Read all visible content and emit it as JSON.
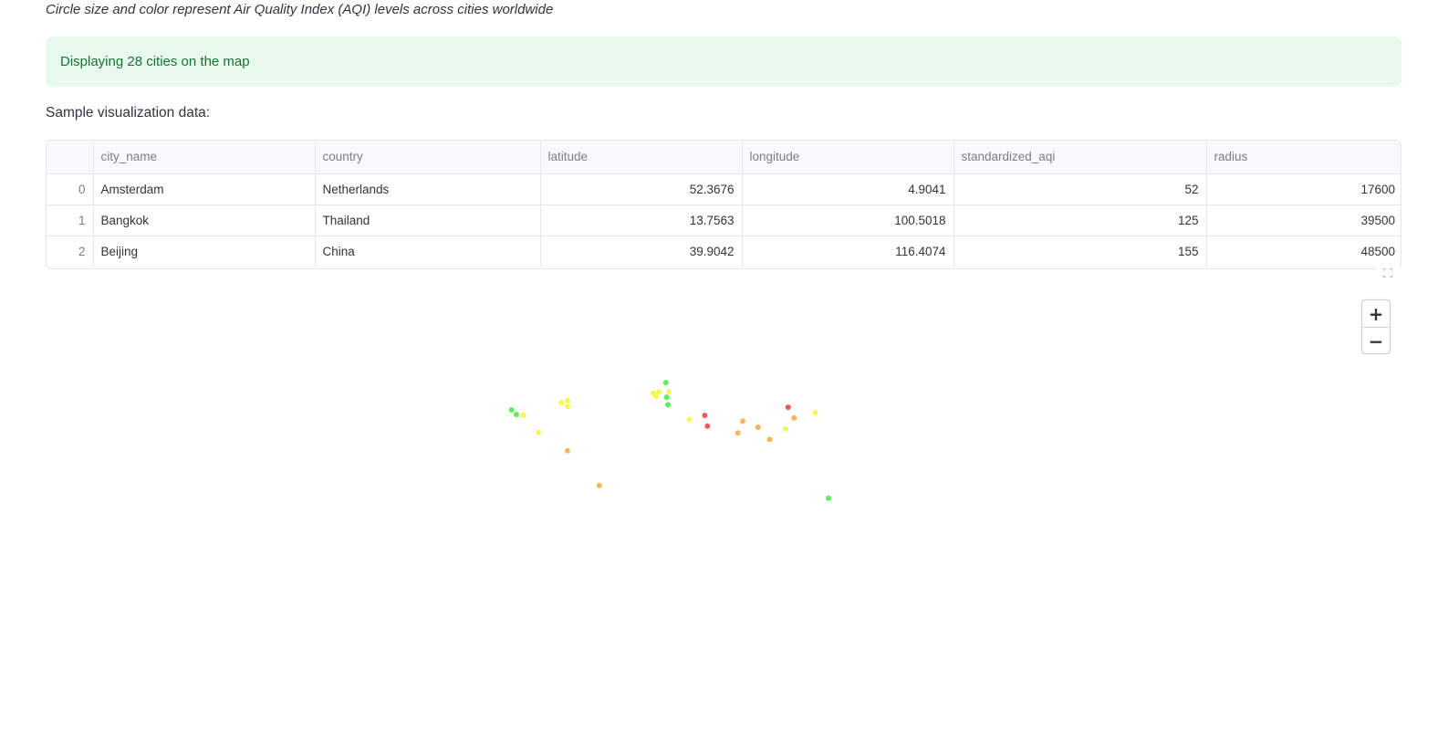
{
  "caption": "Circle size and color represent Air Quality Index (AQI) levels across cities worldwide",
  "success_message": "Displaying 28 cities on the map",
  "table_heading": "Sample visualization data:",
  "table": {
    "columns": [
      "",
      "city_name",
      "country",
      "latitude",
      "longitude",
      "standardized_aqi",
      "radius"
    ],
    "rows": [
      [
        "0",
        "Amsterdam",
        "Netherlands",
        "52.3676",
        "4.9041",
        "52",
        "17600"
      ],
      [
        "1",
        "Bangkok",
        "Thailand",
        "13.7563",
        "100.5018",
        "125",
        "39500"
      ],
      [
        "2",
        "Beijing",
        "China",
        "39.9042",
        "116.4074",
        "155",
        "48500"
      ]
    ]
  },
  "map": {
    "zoom_in_label": "+",
    "zoom_out_label": "−",
    "fullscreen_icon": "fullscreen-icon",
    "point_colors": {
      "green": "#3cf03c",
      "yellow": "#f5f53c",
      "orange": "#f5a93c",
      "red": "#f03c3c"
    },
    "points": [
      {
        "lon": -122.4,
        "lat": 37.8,
        "level": "green"
      },
      {
        "lon": -118.2,
        "lat": 34.1,
        "level": "green"
      },
      {
        "lon": -112.1,
        "lat": 33.5,
        "level": "yellow"
      },
      {
        "lon": -99.1,
        "lat": 19.4,
        "level": "yellow"
      },
      {
        "lon": -79.4,
        "lat": 43.7,
        "level": "yellow"
      },
      {
        "lon": -73.9,
        "lat": 40.7,
        "level": "yellow"
      },
      {
        "lon": -74.0,
        "lat": 45.5,
        "level": "yellow"
      },
      {
        "lon": -74.1,
        "lat": 4.7,
        "level": "orange"
      },
      {
        "lon": -46.6,
        "lat": -23.5,
        "level": "orange"
      },
      {
        "lon": -0.1,
        "lat": 51.5,
        "level": "yellow"
      },
      {
        "lon": 2.4,
        "lat": 48.9,
        "level": "yellow"
      },
      {
        "lon": 4.9,
        "lat": 52.4,
        "level": "yellow"
      },
      {
        "lon": 13.4,
        "lat": 52.5,
        "level": "yellow"
      },
      {
        "lon": 11.6,
        "lat": 48.1,
        "level": "green"
      },
      {
        "lon": 10.8,
        "lat": 59.9,
        "level": "green"
      },
      {
        "lon": 12.6,
        "lat": 41.9,
        "level": "green"
      },
      {
        "lon": 31.2,
        "lat": 30.0,
        "level": "yellow"
      },
      {
        "lon": 46.7,
        "lat": 24.7,
        "level": "red"
      },
      {
        "lon": 44.4,
        "lat": 33.3,
        "level": "red"
      },
      {
        "lon": 77.2,
        "lat": 28.6,
        "level": "orange"
      },
      {
        "lon": 72.9,
        "lat": 19.1,
        "level": "orange"
      },
      {
        "lon": 90.4,
        "lat": 23.8,
        "level": "orange"
      },
      {
        "lon": 100.5,
        "lat": 13.8,
        "level": "orange"
      },
      {
        "lon": 116.4,
        "lat": 39.9,
        "level": "red"
      },
      {
        "lon": 121.5,
        "lat": 31.2,
        "level": "orange"
      },
      {
        "lon": 114.2,
        "lat": 22.3,
        "level": "yellow"
      },
      {
        "lon": 139.7,
        "lat": 35.7,
        "level": "yellow"
      },
      {
        "lon": 151.2,
        "lat": -33.9,
        "level": "green"
      }
    ]
  }
}
